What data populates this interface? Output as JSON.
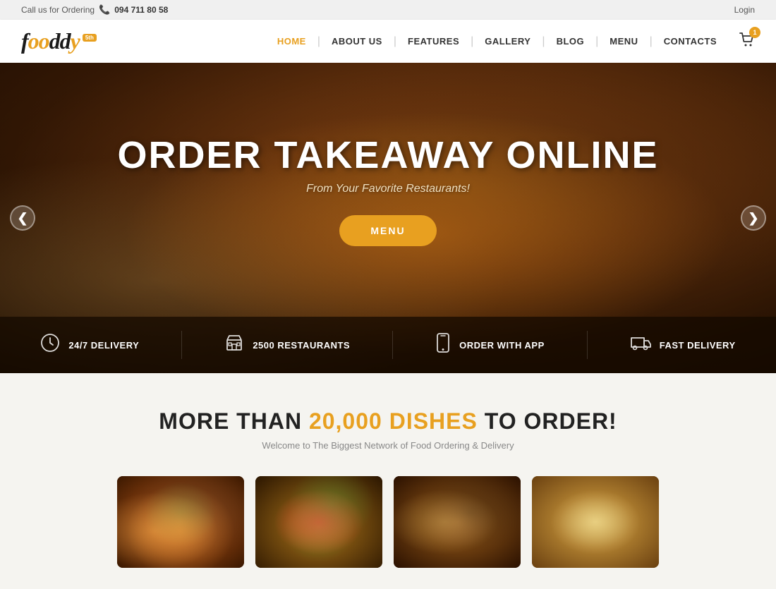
{
  "topbar": {
    "call_label": "Call us for Ordering",
    "phone": "094 711 80 58",
    "login_label": "Login"
  },
  "header": {
    "logo_text": "fooddy",
    "logo_badge": "5th",
    "cart_count": "1",
    "nav": [
      {
        "id": "home",
        "label": "HOME",
        "active": true
      },
      {
        "id": "about",
        "label": "ABOUT US",
        "active": false
      },
      {
        "id": "features",
        "label": "FEATURES",
        "active": false
      },
      {
        "id": "gallery",
        "label": "GALLERY",
        "active": false
      },
      {
        "id": "blog",
        "label": "BLOG",
        "active": false
      },
      {
        "id": "menu",
        "label": "MENU",
        "active": false
      },
      {
        "id": "contacts",
        "label": "CONTACTS",
        "active": false
      }
    ]
  },
  "hero": {
    "title": "ORDER TAKEAWAY ONLINE",
    "subtitle": "From Your Favorite Restaurants!",
    "cta_label": "MENU",
    "arrow_left": "❮",
    "arrow_right": "❯",
    "stats": [
      {
        "id": "delivery-247",
        "icon": "🕐",
        "label": "24/7 DELIVERY"
      },
      {
        "id": "restaurants",
        "icon": "🏪",
        "label": "2500 RESTAURANTS"
      },
      {
        "id": "order-app",
        "icon": "📱",
        "label": "ORDER WITH APP"
      },
      {
        "id": "fast-delivery",
        "icon": "🚚",
        "label": "FAST DELIVERY"
      }
    ]
  },
  "dishes_section": {
    "title_pre": "MORE THAN ",
    "title_highlight": "20,000 DISHES",
    "title_post": " TO ORDER!",
    "subtitle": "Welcome to The Biggest Network of Food Ordering & Delivery",
    "dishes": [
      {
        "id": "sushi",
        "alt": "Sushi dish"
      },
      {
        "id": "pizza",
        "alt": "Pizza dish"
      },
      {
        "id": "burger",
        "alt": "Burger dish"
      },
      {
        "id": "pastry",
        "alt": "Pastry dish"
      }
    ]
  }
}
